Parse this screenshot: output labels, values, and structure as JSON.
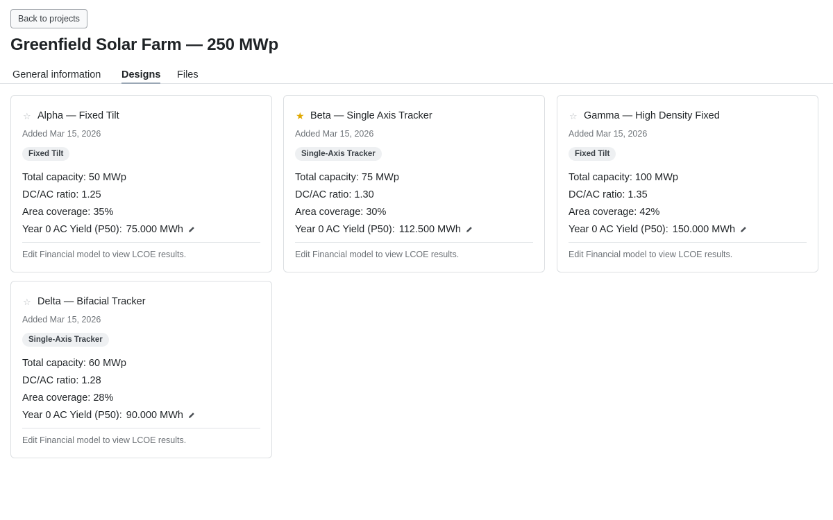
{
  "back_label": "Back to projects",
  "page_title": "Greenfield Solar Farm — 250 MWp",
  "tabs": [
    {
      "label": "General information"
    },
    {
      "label": "Designs"
    },
    {
      "label": "Files"
    }
  ],
  "active_tab": "Designs",
  "favorite_color": "#e0a800",
  "icons": {
    "favorite": "star-icon",
    "edit": "pencil-icon"
  },
  "designs": [
    {
      "name": "Alpha — Fixed Tilt",
      "favorite": false,
      "added": "Added Mar 15, 2026",
      "badge": "Fixed Tilt",
      "capacity": "Total capacity: 50 MWp",
      "dcac": "DC/AC ratio: 1.25",
      "area": "Area coverage: 35%",
      "yield_label": "Year 0 AC Yield (P50):",
      "yield_value": "75.000 MWh",
      "lcoe_note": "Edit Financial model to view LCOE results."
    },
    {
      "name": "Beta — Single Axis Tracker",
      "favorite": true,
      "added": "Added Mar 15, 2026",
      "badge": "Single-Axis Tracker",
      "capacity": "Total capacity: 75 MWp",
      "dcac": "DC/AC ratio: 1.30",
      "area": "Area coverage: 30%",
      "yield_label": "Year 0 AC Yield (P50):",
      "yield_value": "112.500 MWh",
      "lcoe_note": "Edit Financial model to view LCOE results."
    },
    {
      "name": "Gamma — High Density Fixed",
      "favorite": false,
      "added": "Added Mar 15, 2026",
      "badge": "Fixed Tilt",
      "capacity": "Total capacity: 100 MWp",
      "dcac": "DC/AC ratio: 1.35",
      "area": "Area coverage: 42%",
      "yield_label": "Year 0 AC Yield (P50):",
      "yield_value": "150.000 MWh",
      "lcoe_note": "Edit Financial model to view LCOE results."
    },
    {
      "name": "Delta — Bifacial Tracker",
      "favorite": false,
      "added": "Added Mar 15, 2026",
      "badge": "Single-Axis Tracker",
      "capacity": "Total capacity: 60 MWp",
      "dcac": "DC/AC ratio: 1.28",
      "area": "Area coverage: 28%",
      "yield_label": "Year 0 AC Yield (P50):",
      "yield_value": "90.000 MWh",
      "lcoe_note": "Edit Financial model to view LCOE results."
    }
  ]
}
